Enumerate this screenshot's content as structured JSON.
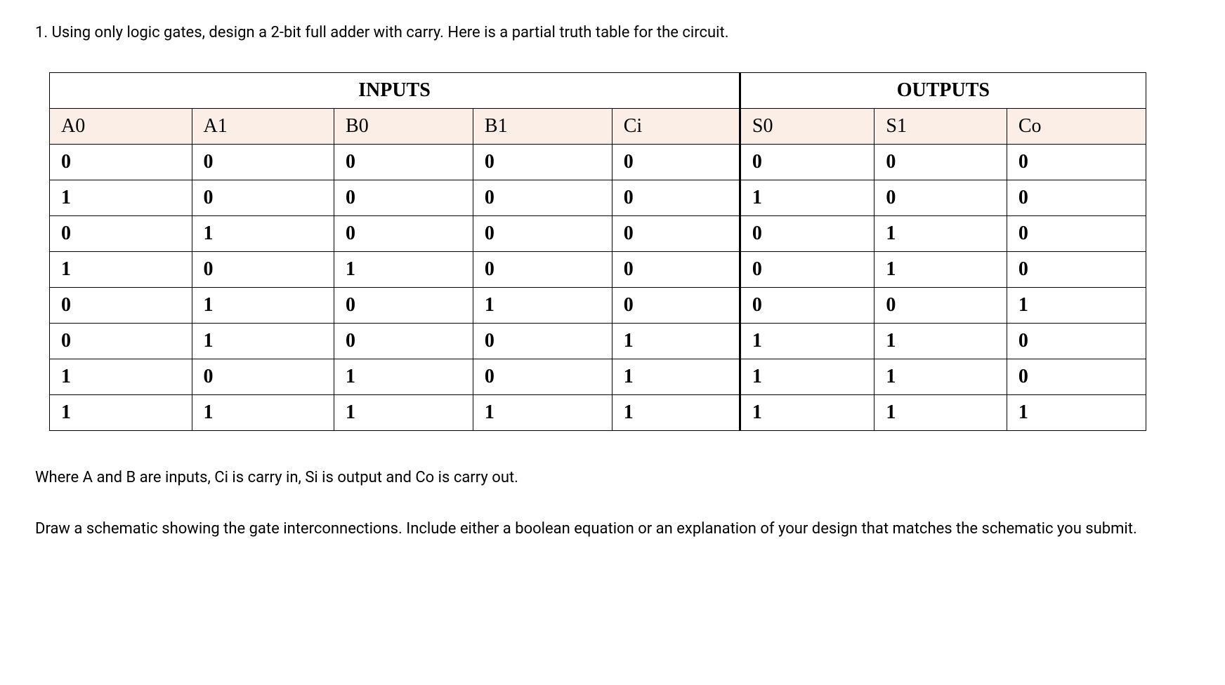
{
  "question": "1. Using only logic gates, design a 2-bit full adder with carry. Here is a partial truth table for the circuit.",
  "table": {
    "section_headers": {
      "inputs": "INPUTS",
      "outputs": "OUTPUTS"
    },
    "columns": {
      "a0": "A0",
      "a1": "A1",
      "b0": "B0",
      "b1": "B1",
      "ci": "Ci",
      "s0": "S0",
      "s1": "S1",
      "co": "Co"
    },
    "rows": [
      {
        "a0": "0",
        "a1": "0",
        "b0": "0",
        "b1": "0",
        "ci": "0",
        "s0": "0",
        "s1": "0",
        "co": "0"
      },
      {
        "a0": "1",
        "a1": "0",
        "b0": "0",
        "b1": "0",
        "ci": "0",
        "s0": "1",
        "s1": "0",
        "co": "0"
      },
      {
        "a0": "0",
        "a1": "1",
        "b0": "0",
        "b1": "0",
        "ci": "0",
        "s0": "0",
        "s1": "1",
        "co": "0"
      },
      {
        "a0": "1",
        "a1": "0",
        "b0": "1",
        "b1": "0",
        "ci": "0",
        "s0": "0",
        "s1": "1",
        "co": "0"
      },
      {
        "a0": "0",
        "a1": "1",
        "b0": "0",
        "b1": "1",
        "ci": "0",
        "s0": "0",
        "s1": "0",
        "co": "1"
      },
      {
        "a0": "0",
        "a1": "1",
        "b0": "0",
        "b1": "0",
        "ci": "1",
        "s0": "1",
        "s1": "1",
        "co": "0"
      },
      {
        "a0": "1",
        "a1": "0",
        "b0": "1",
        "b1": "0",
        "ci": "1",
        "s0": "1",
        "s1": "1",
        "co": "0"
      },
      {
        "a0": "1",
        "a1": "1",
        "b0": "1",
        "b1": "1",
        "ci": "1",
        "s0": "1",
        "s1": "1",
        "co": "1"
      }
    ]
  },
  "description": "Where A and B are inputs, Ci is carry in, Si is output and Co is carry out.",
  "instruction": "Draw a schematic showing the gate interconnections. Include either a boolean equation or an explanation of your design that matches the schematic you submit.",
  "chart_data": {
    "type": "table",
    "title": "2-bit full adder partial truth table",
    "sections": [
      "INPUTS",
      "OUTPUTS"
    ],
    "columns": [
      "A0",
      "A1",
      "B0",
      "B1",
      "Ci",
      "S0",
      "S1",
      "Co"
    ],
    "rows": [
      [
        0,
        0,
        0,
        0,
        0,
        0,
        0,
        0
      ],
      [
        1,
        0,
        0,
        0,
        0,
        1,
        0,
        0
      ],
      [
        0,
        1,
        0,
        0,
        0,
        0,
        1,
        0
      ],
      [
        1,
        0,
        1,
        0,
        0,
        0,
        1,
        0
      ],
      [
        0,
        1,
        0,
        1,
        0,
        0,
        0,
        1
      ],
      [
        0,
        1,
        0,
        0,
        1,
        1,
        1,
        0
      ],
      [
        1,
        0,
        1,
        0,
        1,
        1,
        1,
        0
      ],
      [
        1,
        1,
        1,
        1,
        1,
        1,
        1,
        1
      ]
    ]
  }
}
